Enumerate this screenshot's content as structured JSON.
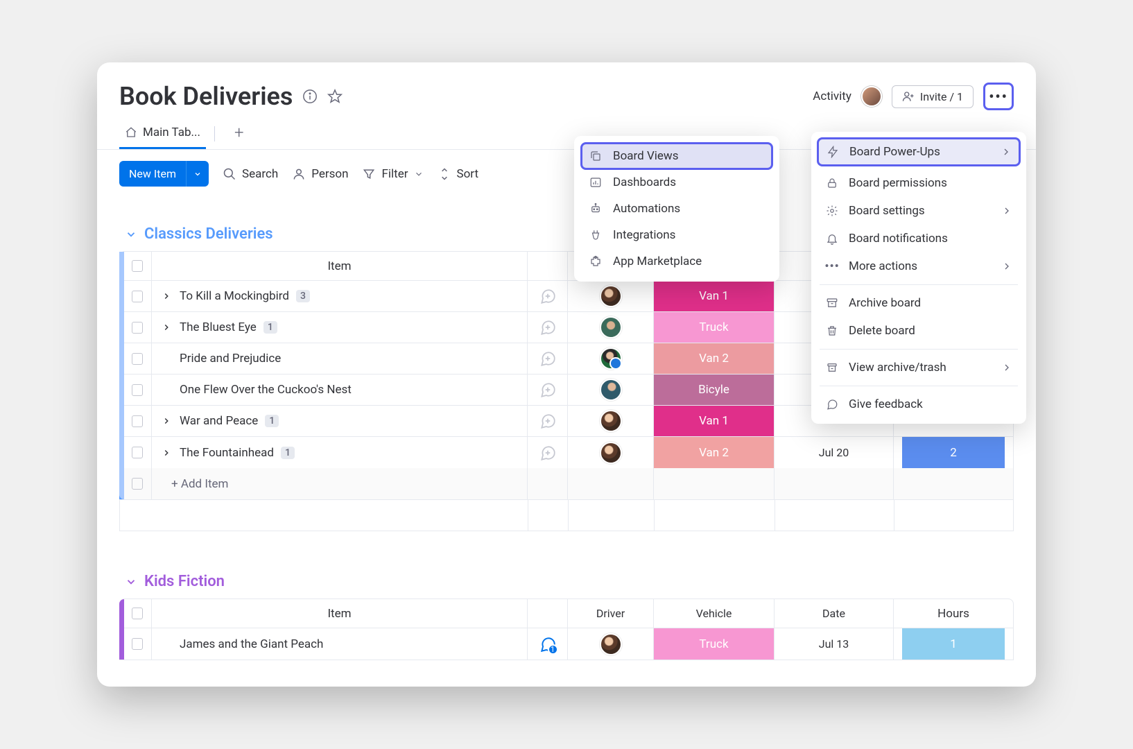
{
  "header": {
    "title": "Book Deliveries",
    "activity_label": "Activity",
    "invite_label": "Invite / 1"
  },
  "tabs": {
    "main": "Main Tab..."
  },
  "toolbar": {
    "new_item": "New Item",
    "search": "Search",
    "person": "Person",
    "filter": "Filter",
    "sort": "Sort"
  },
  "columns": {
    "item": "Item",
    "driver": "Driver",
    "vehicle": "Vehicle",
    "date": "Date",
    "hours": "Hours"
  },
  "groups": {
    "classics": {
      "name": "Classics Deliveries",
      "add_item": "+ Add Item",
      "rows": [
        {
          "item": "To Kill a Mockingbird",
          "sub": "3",
          "expand": true,
          "avatar": "av1",
          "vehicle": "Van 1",
          "vcolor": "vc-van1"
        },
        {
          "item": "The Bluest Eye",
          "sub": "1",
          "expand": true,
          "avatar": "av2",
          "vehicle": "Truck",
          "vcolor": "vc-truck"
        },
        {
          "item": "Pride and Prejudice",
          "sub": null,
          "expand": false,
          "avatar": "av3",
          "vehicle": "Van 2",
          "vcolor": "vc-van2"
        },
        {
          "item": "One Flew Over the Cuckoo's Nest",
          "sub": null,
          "expand": false,
          "avatar": "av4",
          "vehicle": "Bicyle",
          "vcolor": "vc-bicyle"
        },
        {
          "item": "War and Peace",
          "sub": "1",
          "expand": true,
          "avatar": "av1",
          "vehicle": "Van 1",
          "vcolor": "vc-van1"
        },
        {
          "item": "The Fountainhead",
          "sub": "1",
          "expand": true,
          "avatar": "av1",
          "vehicle": "Van 2",
          "vcolor": "vc-van2b",
          "date": "Jul 20",
          "hours": "2",
          "hcolor": "hc-2"
        }
      ]
    },
    "kids": {
      "name": "Kids Fiction",
      "rows": [
        {
          "item": "James and the Giant Peach",
          "avatar": "av1",
          "vehicle": "Truck",
          "vcolor": "vc-truck",
          "date": "Jul 13",
          "hours": "1",
          "hcolor": "hc-1",
          "conv_count": "1"
        }
      ]
    }
  },
  "menu_left": {
    "views": "Board Views",
    "dashboards": "Dashboards",
    "automations": "Automations",
    "integrations": "Integrations",
    "marketplace": "App Marketplace"
  },
  "menu_right": {
    "powerups": "Board Power-Ups",
    "permissions": "Board permissions",
    "settings": "Board settings",
    "notifications": "Board notifications",
    "more": "More actions",
    "archive": "Archive board",
    "delete": "Delete board",
    "view_archive": "View archive/trash",
    "feedback": "Give feedback"
  }
}
